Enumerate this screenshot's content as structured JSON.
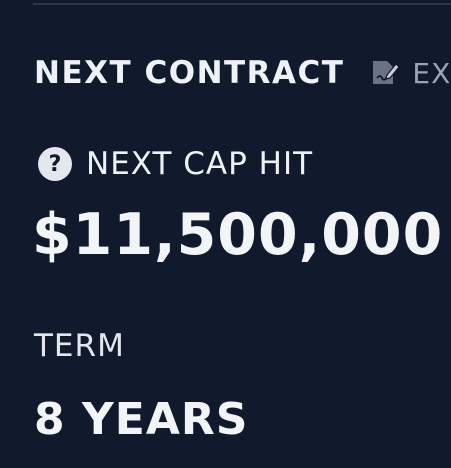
{
  "section": {
    "title": "NEXT CONTRACT",
    "link_label": "EX",
    "link_icon": "contract-edit-icon"
  },
  "cap_hit": {
    "help_icon": "question-circle-icon",
    "help_glyph": "?",
    "label": "NEXT CAP HIT",
    "value": "$11,500,000"
  },
  "term": {
    "label": "TERM",
    "value": "8 YEARS"
  },
  "colors": {
    "background": "#111a2c",
    "text": "#eef1f6",
    "muted": "#9ca3b0",
    "help_circle": "#e4e7ed"
  }
}
